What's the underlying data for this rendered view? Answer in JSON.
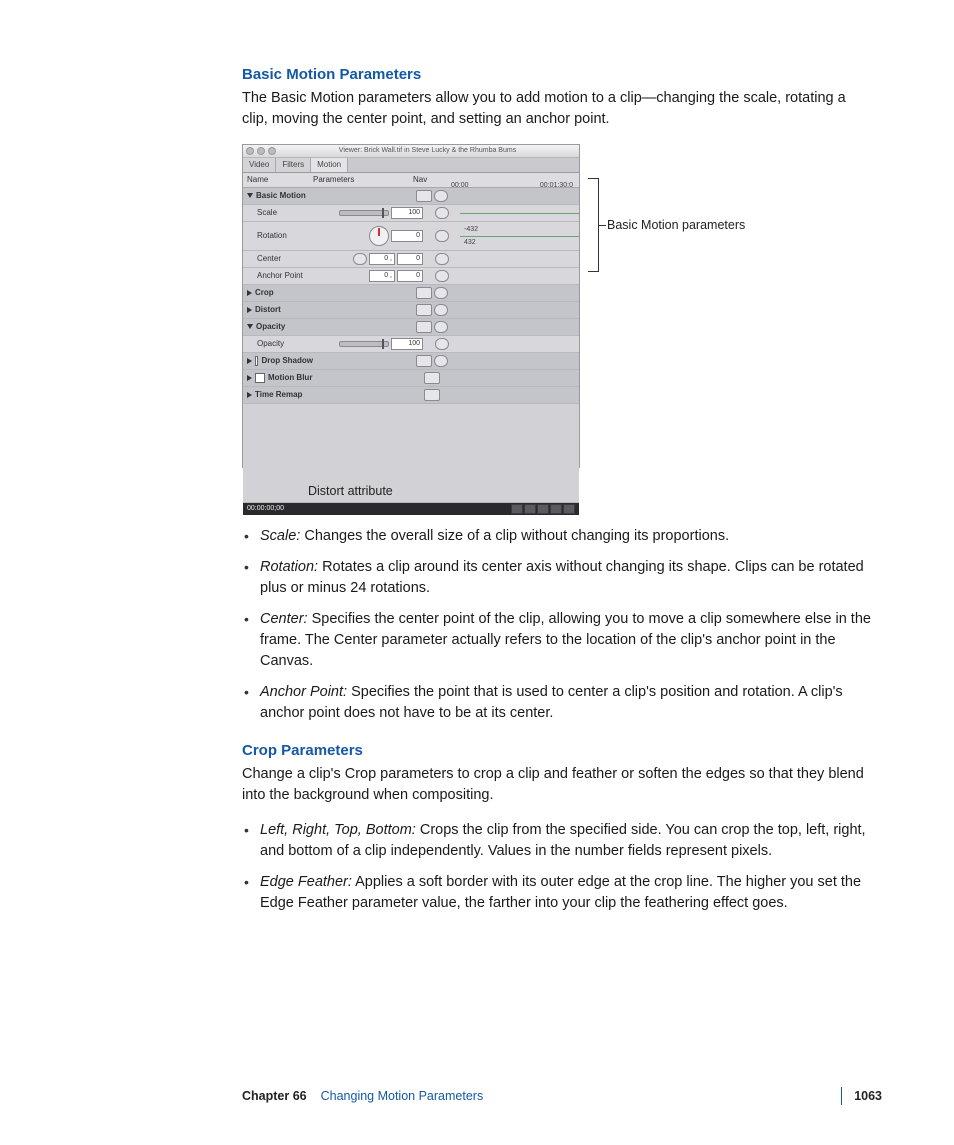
{
  "section1": {
    "title": "Basic Motion Parameters",
    "intro": "The Basic Motion parameters allow you to add motion to a clip—changing the scale, rotating a clip, moving the center point, and setting an anchor point."
  },
  "viewer": {
    "title": "Viewer: Brick Wall.tif in Steve Lucky & the Rhumba Bums",
    "tabs": [
      "Video",
      "Filters",
      "Motion"
    ],
    "headers": {
      "name": "Name",
      "params": "Parameters",
      "nav": "Nav"
    },
    "timeline": {
      "left": "00:00",
      "right": "00:01:30:0"
    },
    "rows": {
      "basic_motion": "Basic Motion",
      "scale": {
        "label": "Scale",
        "value": "100"
      },
      "rotation": {
        "label": "Rotation",
        "value": "0",
        "tl_top": "432",
        "tl_bot": "-432"
      },
      "center": {
        "label": "Center",
        "v1": "0 ,",
        "v2": "0"
      },
      "anchor": {
        "label": "Anchor Point",
        "v1": "0 ,",
        "v2": "0"
      },
      "crop": "Crop",
      "distort": "Distort",
      "opacity_group": "Opacity",
      "opacity": {
        "label": "Opacity",
        "value": "100"
      },
      "drop_shadow": "Drop Shadow",
      "motion_blur": "Motion Blur",
      "time_remap": "Time Remap"
    },
    "status_time": "00:00:00;00"
  },
  "callouts": {
    "right": "Basic Motion parameters",
    "bottom": "Distort attribute"
  },
  "bullets1": [
    {
      "term": "Scale:",
      "text": "  Changes the overall size of a clip without changing its proportions."
    },
    {
      "term": "Rotation:",
      "text": "  Rotates a clip around its center axis without changing its shape. Clips can be rotated plus or minus 24 rotations."
    },
    {
      "term": "Center:",
      "text": "  Specifies the center point of the clip, allowing you to move a clip somewhere else in the frame. The Center parameter actually refers to the location of the clip's anchor point in the Canvas."
    },
    {
      "term": "Anchor Point:",
      "text": "  Specifies the point that is used to center a clip's position and rotation. A clip's anchor point does not have to be at its center."
    }
  ],
  "section2": {
    "title": "Crop Parameters",
    "intro": "Change a clip's Crop parameters to crop a clip and feather or soften the edges so that they blend into the background when compositing."
  },
  "bullets2": [
    {
      "term": "Left, Right, Top, Bottom:",
      "text": "  Crops the clip from the specified side. You can crop the top, left, right, and bottom of a clip independently. Values in the number fields represent pixels."
    },
    {
      "term": "Edge Feather:",
      "text": "  Applies a soft border with its outer edge at the crop line. The higher you set the Edge Feather parameter value, the farther into your clip the feathering effect goes."
    }
  ],
  "footer": {
    "chapter": "Chapter 66",
    "name": "Changing Motion Parameters",
    "page": "1063"
  }
}
